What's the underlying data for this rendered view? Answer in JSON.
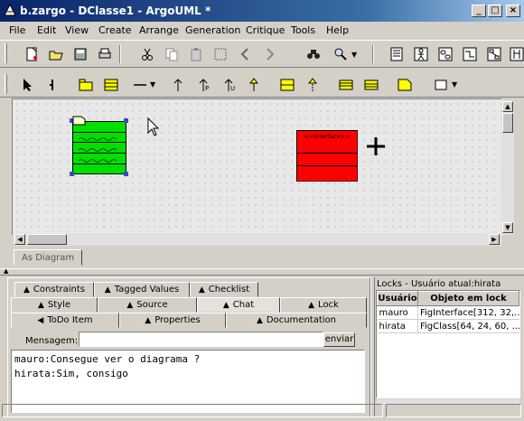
{
  "window": {
    "title": "b.zargo - DClasse1 - ArgoUML *"
  },
  "menu": [
    "File",
    "Edit",
    "View",
    "Create",
    "Arrange",
    "Generation",
    "Critique",
    "Tools",
    "Help"
  ],
  "diagram": {
    "interface_stereotype": "<<Interface>>",
    "tab_label": "As Diagram"
  },
  "tabs": {
    "row1": [
      "Constraints",
      "Tagged Values",
      "Checklist"
    ],
    "row2": [
      "Style",
      "Source",
      "Chat",
      "Lock"
    ],
    "row3": [
      "ToDo Item",
      "Properties",
      "Documentation"
    ]
  },
  "chat": {
    "message_label": "Mensagem:",
    "message_value": "",
    "send_label": "enviar",
    "lines": [
      "mauro:Consegue ver o diagrama ?",
      "hirata:Sim, consigo"
    ]
  },
  "locks": {
    "title": "Locks - Usuário atual:hirata",
    "columns": [
      "Usuário",
      "Objeto em lock"
    ],
    "rows": [
      [
        "mauro",
        "FigInterface[312, 32,..."
      ],
      [
        "hirata",
        "FigClass[64, 24, 60, ..."
      ]
    ]
  },
  "colors": {
    "class_fill": "#00e000",
    "interface_fill": "#ff0000",
    "title_bar": "#0a246a"
  }
}
